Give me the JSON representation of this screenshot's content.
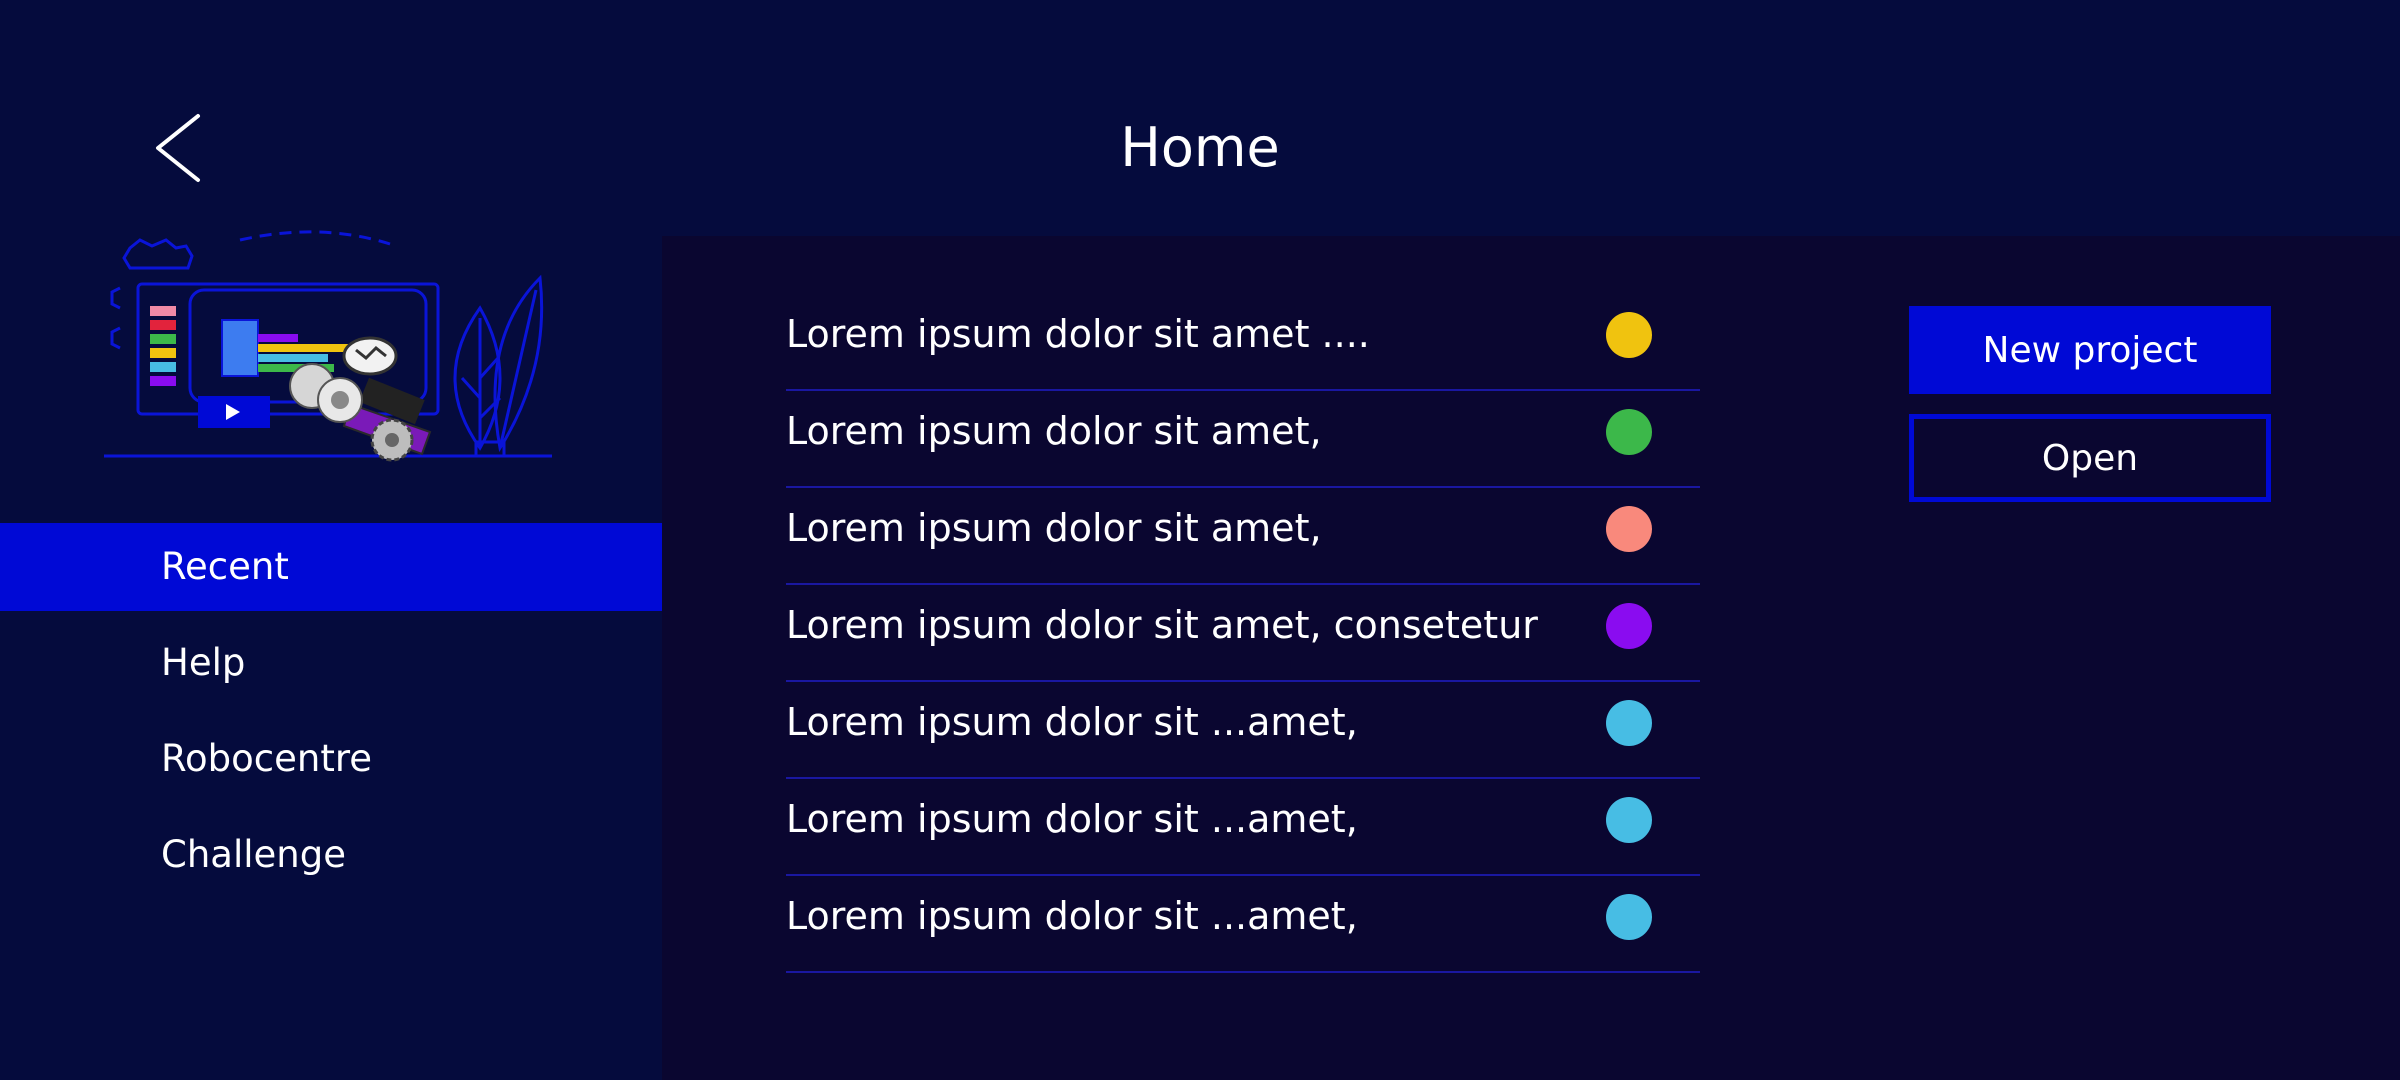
{
  "header": {
    "title": "Home",
    "back_icon": "chevron-left-icon"
  },
  "sidebar": {
    "illustration": "robotics-coding-illustration",
    "items": [
      {
        "label": "Recent",
        "active": true
      },
      {
        "label": "Help",
        "active": false
      },
      {
        "label": "Robocentre",
        "active": false
      },
      {
        "label": "Challenge",
        "active": false
      }
    ]
  },
  "recent": {
    "items": [
      {
        "label": "Lorem ipsum dolor sit amet ....",
        "color": "#f0c30f"
      },
      {
        "label": "Lorem ipsum dolor sit amet,",
        "color": "#3cb84a"
      },
      {
        "label": "Lorem ipsum dolor sit amet,",
        "color": "#f9897c"
      },
      {
        "label": "Lorem ipsum dolor sit amet, consetetur",
        "color": "#8a0cf0"
      },
      {
        "label": "Lorem ipsum dolor sit ...amet,",
        "color": "#47bde4"
      },
      {
        "label": "Lorem ipsum dolor sit ...amet,",
        "color": "#47bde4"
      },
      {
        "label": "Lorem ipsum dolor sit ...amet,",
        "color": "#47bde4"
      }
    ]
  },
  "actions": {
    "new_project_label": "New project",
    "open_label": "Open"
  },
  "colors": {
    "background": "#050b3d",
    "panel": "#0a0630",
    "accent": "#0009d6",
    "divider": "#1a17a0"
  }
}
